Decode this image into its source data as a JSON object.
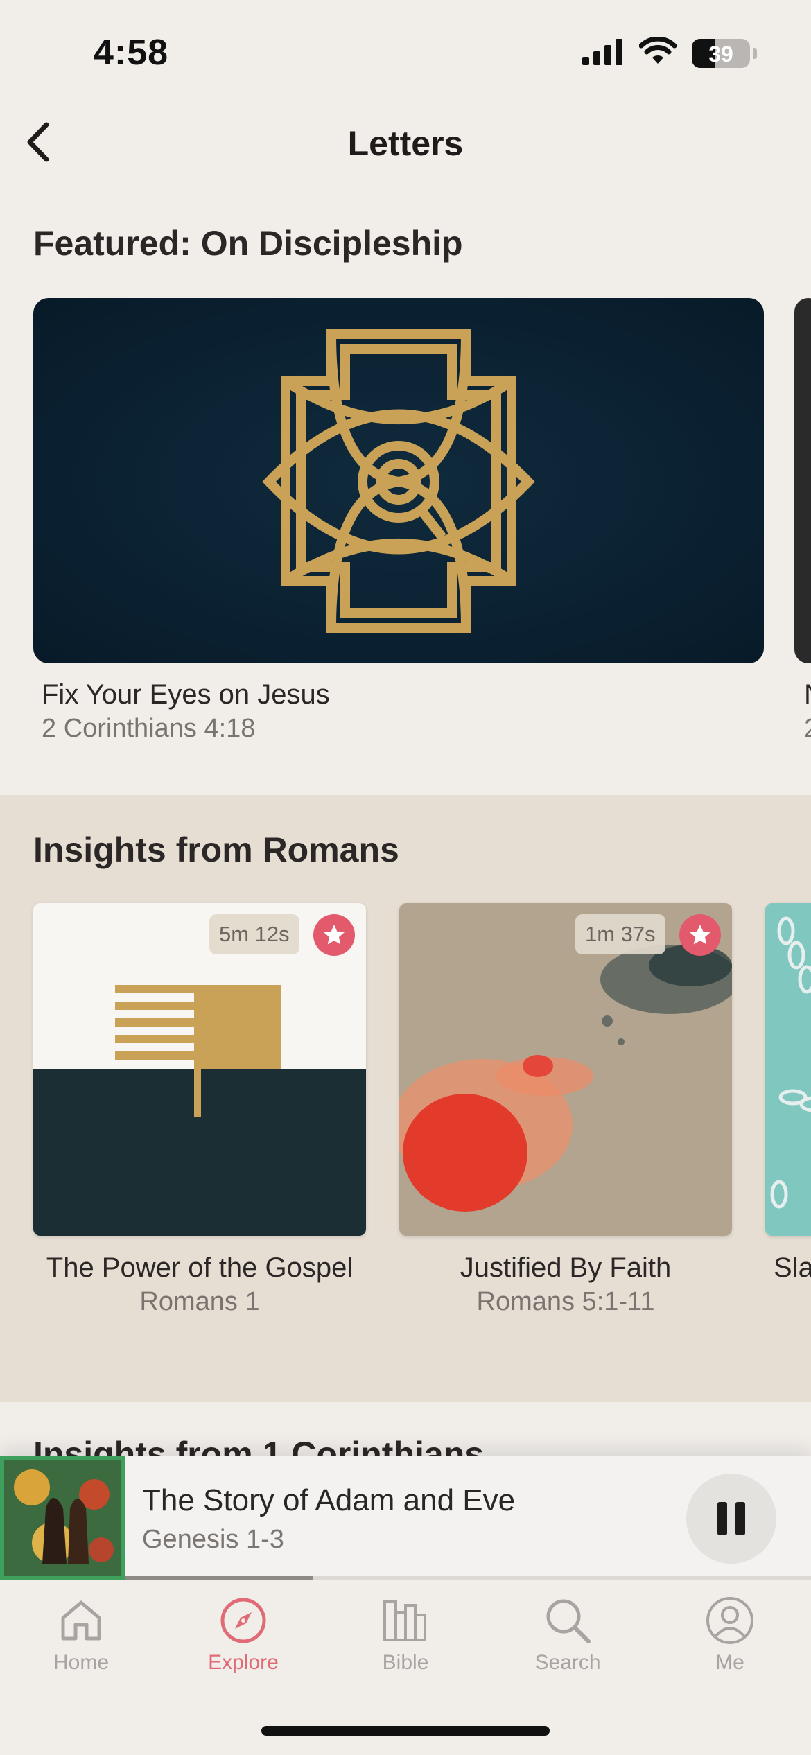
{
  "status_bar": {
    "time": "4:58",
    "battery_percent": "39"
  },
  "nav": {
    "title": "Letters",
    "back_icon": "chevron-left-icon"
  },
  "featured": {
    "title": "Featured: On Discipleship",
    "item": {
      "title": "Fix Your Eyes on Jesus",
      "subtitle": "2 Corinthians 4:18"
    },
    "next_item_partial": {
      "title": "N",
      "subtitle": "2"
    }
  },
  "romans": {
    "title": "Insights from Romans",
    "items": [
      {
        "title": "The Power of the Gospel",
        "subtitle": "Romans 1",
        "duration": "5m 12s",
        "starred": true
      },
      {
        "title": "Justified By Faith",
        "subtitle": "Romans 5:1-11",
        "duration": "1m 37s",
        "starred": true
      },
      {
        "title": "Sla",
        "subtitle": ""
      }
    ]
  },
  "next_section": {
    "title": "Insights from 1 Corinthians"
  },
  "mini_player": {
    "title": "The Story of Adam and Eve",
    "subtitle": "Genesis 1-3",
    "progress": 0.275
  },
  "tabs": [
    {
      "label": "Home",
      "icon": "home-icon",
      "active": false
    },
    {
      "label": "Explore",
      "icon": "compass-icon",
      "active": true
    },
    {
      "label": "Bible",
      "icon": "bible-icon",
      "active": false
    },
    {
      "label": "Search",
      "icon": "search-icon",
      "active": false
    },
    {
      "label": "Me",
      "icon": "person-icon",
      "active": false
    }
  ],
  "colors": {
    "accent": "#e06a75",
    "star": "#e25a6b",
    "gold": "#c9a257",
    "navy": "#0b2233"
  }
}
